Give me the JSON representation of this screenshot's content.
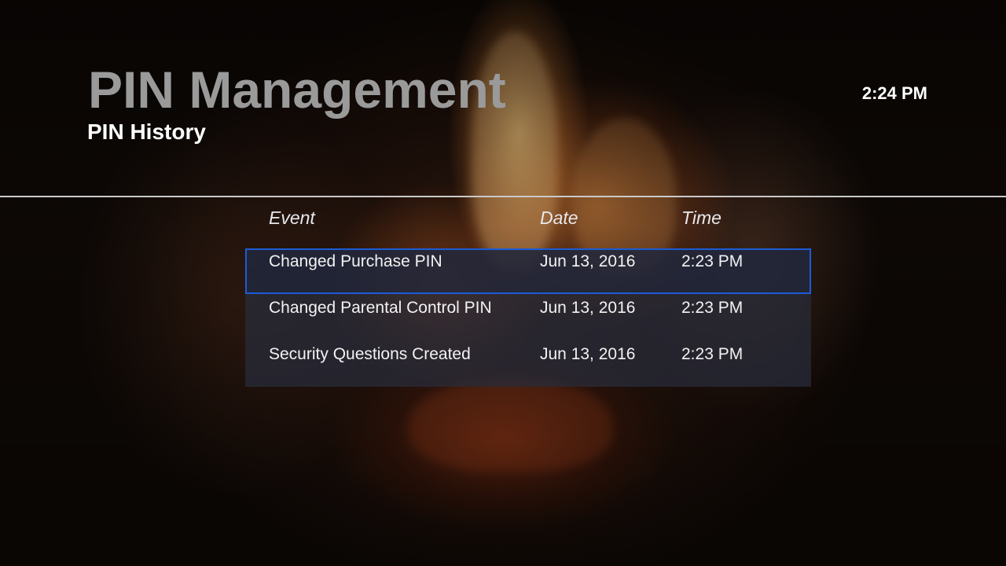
{
  "header": {
    "title": "PIN Management",
    "subtitle": "PIN History",
    "clock": "2:24 PM"
  },
  "table": {
    "columns": {
      "event": "Event",
      "date": "Date",
      "time": "Time"
    },
    "rows": [
      {
        "event": "Changed Purchase PIN",
        "date": "Jun 13, 2016",
        "time": "2:23 PM",
        "selected": true
      },
      {
        "event": "Changed Parental Control PIN",
        "date": "Jun 13, 2016",
        "time": "2:23 PM",
        "selected": false
      },
      {
        "event": "Security Questions Created",
        "date": "Jun 13, 2016",
        "time": "2:23 PM",
        "selected": false
      }
    ]
  },
  "colors": {
    "selection_border": "#1d5bd6",
    "title_gray": "#9a9a9a",
    "divider": "#c9c9c9"
  }
}
